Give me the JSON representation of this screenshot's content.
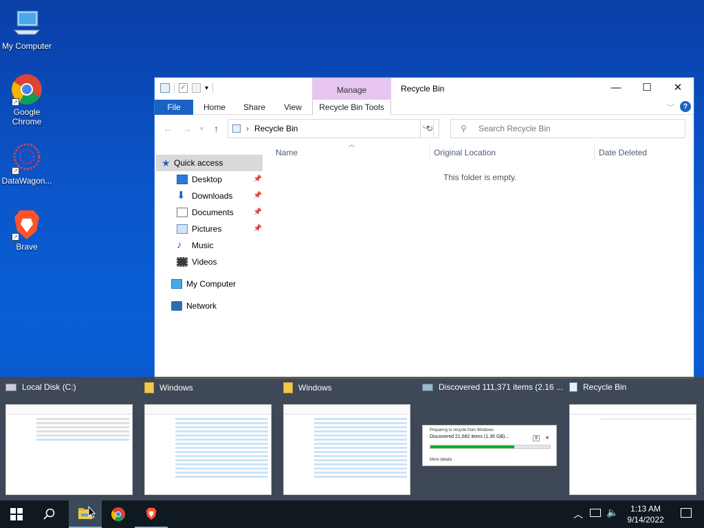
{
  "desktop": {
    "icons": [
      {
        "label": "My Computer"
      },
      {
        "label": "Google Chrome"
      },
      {
        "label": "DataWagon..."
      },
      {
        "label": "Brave"
      }
    ]
  },
  "window": {
    "title": "Recycle Bin",
    "context_tab": "Manage",
    "ribbon_tabs": [
      "File",
      "Home",
      "Share",
      "View",
      "Recycle Bin Tools"
    ],
    "address": "Recycle Bin",
    "search_placeholder": "Search Recycle Bin",
    "nav": {
      "quick_access": "Quick access",
      "items": [
        "Desktop",
        "Downloads",
        "Documents",
        "Pictures",
        "Music",
        "Videos"
      ],
      "my_computer": "My Computer",
      "network": "Network"
    },
    "columns": [
      "Name",
      "Original Location",
      "Date Deleted"
    ],
    "empty_text": "This folder is empty."
  },
  "switcher": {
    "items": [
      {
        "title": "Local Disk (C:)"
      },
      {
        "title": "Windows"
      },
      {
        "title": "Windows"
      },
      {
        "title": "Discovered 111,371 items (2.16 ..."
      },
      {
        "title": "Recycle Bin"
      }
    ],
    "dialog": {
      "line1": "Preparing to recycle from Windows",
      "line2": "Discovered 21,682 items (1.35 GB)...",
      "progress": 0.7,
      "more": "More details"
    }
  },
  "taskbar": {
    "time": "1:13 AM",
    "date": "9/14/2022"
  },
  "colors": {
    "accent": "#1a63c5",
    "manage_tab": "#e6c6f0",
    "progress": "#06b025"
  }
}
